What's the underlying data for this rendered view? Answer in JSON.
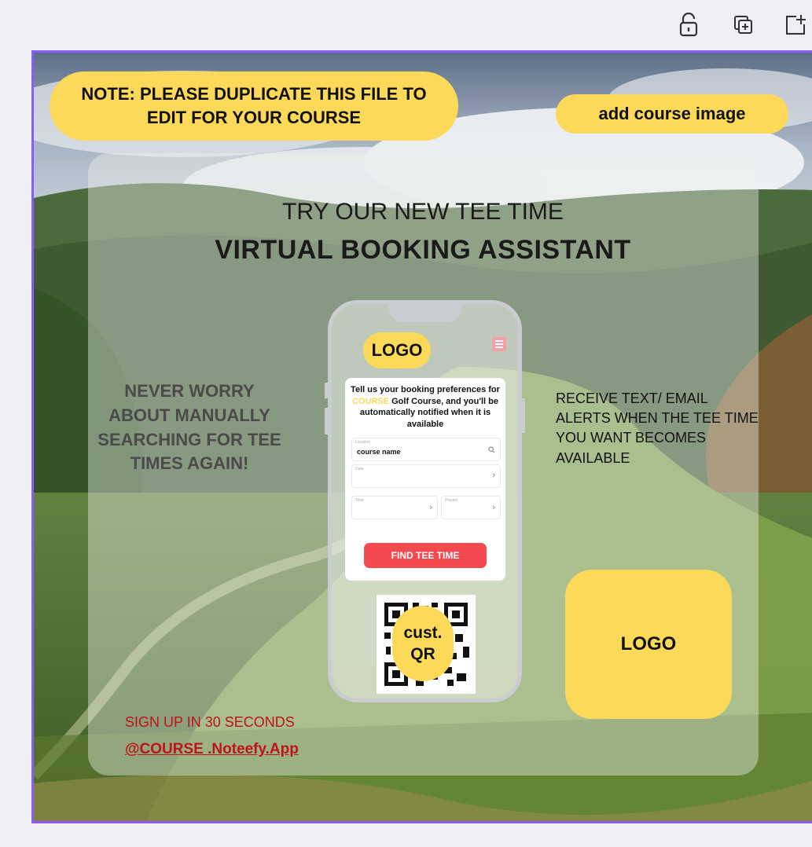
{
  "toolbar": {
    "icons": [
      "unlock-icon",
      "duplicate-page-icon",
      "add-page-icon"
    ]
  },
  "design": {
    "note": "NOTE: PLEASE DUPLICATE THIS FILE TO EDIT FOR YOUR COURSE",
    "add_image": "add course image",
    "headline_line1": "TRY OUR NEW TEE TIME",
    "headline_line2": "VIRTUAL BOOKING ASSISTANT",
    "left_text": "NEVER WORRY ABOUT MANUALLY SEARCHING FOR TEE TIMES AGAIN!",
    "right_text": "RECEIVE TEXT/ EMAIL ALERTS WHEN THE TEE TIME YOU WANT BECOMES AVAILABLE",
    "signup": "SIGN UP IN 30 SECONDS",
    "signup_link": "@COURSE .Noteefy.App",
    "logo_box": "LOGO",
    "phone": {
      "logo": "LOGO",
      "title_pre": "Tell us your booking preferences for",
      "title_highlight": "COURSE",
      "title_post": "Golf Course, and you'll be automatically notified when it is available",
      "location_label": "Location",
      "location_value": "course name",
      "date_label": "Date",
      "time_label": "Time",
      "players_label": "Players",
      "button": "FIND TEE TIME",
      "qr_line1": "cust.",
      "qr_line2": "QR"
    }
  },
  "colors": {
    "accent_yellow": "#fdd95a",
    "frame_purple": "#8b5cf6",
    "signup_red": "#c0121b",
    "button_red": "#f24a4f"
  }
}
